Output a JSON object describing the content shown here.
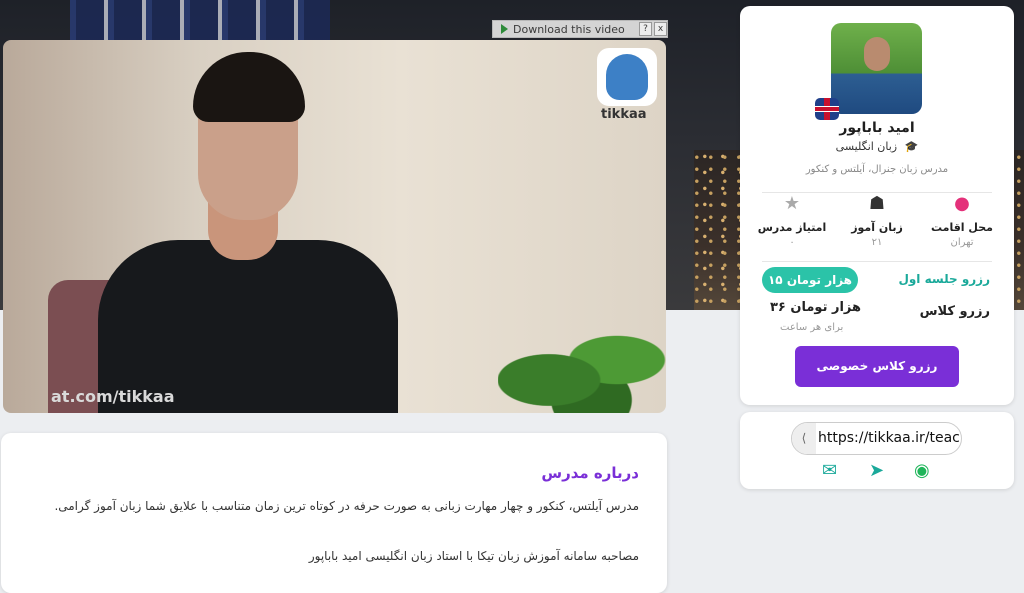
{
  "download": {
    "label": "Download this video",
    "help": "?",
    "close": "x"
  },
  "video": {
    "logo_text": "tikkaa",
    "watermark": "at.com/tikkaa"
  },
  "teacher": {
    "name": "امید باباپور",
    "language": "زبان انگلیسی",
    "bio": "مدرس زبان جنرال، آیلتس و کنکور"
  },
  "stats": [
    {
      "title": "محل اقامت",
      "value": "تهران",
      "icon": "location-pin-icon"
    },
    {
      "title": "زبان آموز",
      "value": "۲۱",
      "icon": "student-icon"
    },
    {
      "title": "امتیاز مدرس",
      "value": "۰",
      "icon": "star-icon"
    }
  ],
  "booking": {
    "first_session_label": "رزرو جلسه اول",
    "first_session_price": "۱۵ هزار تومان",
    "class_label": "رزرو کلاس",
    "class_price": "۳۶ هزار تومان",
    "per_hour": "برای هر ساعت",
    "button": "رزرو کلاس خصوصی"
  },
  "share": {
    "url": "https://tikkaa.ir/teach"
  },
  "about": {
    "title": "درباره مدرس",
    "text": "مدرس آیلتس، کنکور و چهار مهارت زبانی به صورت حرفه در کوتاه ترین زمان متناسب با علایق شما زبان آموز گرامی.",
    "text2": "مصاحبه سامانه آموزش زبان تیکا با استاد زبان انگلیسی امید باباپور"
  },
  "colors": {
    "accent": "#7a2fd7",
    "teal": "#2bc3a8",
    "pink": "#e4317a"
  }
}
